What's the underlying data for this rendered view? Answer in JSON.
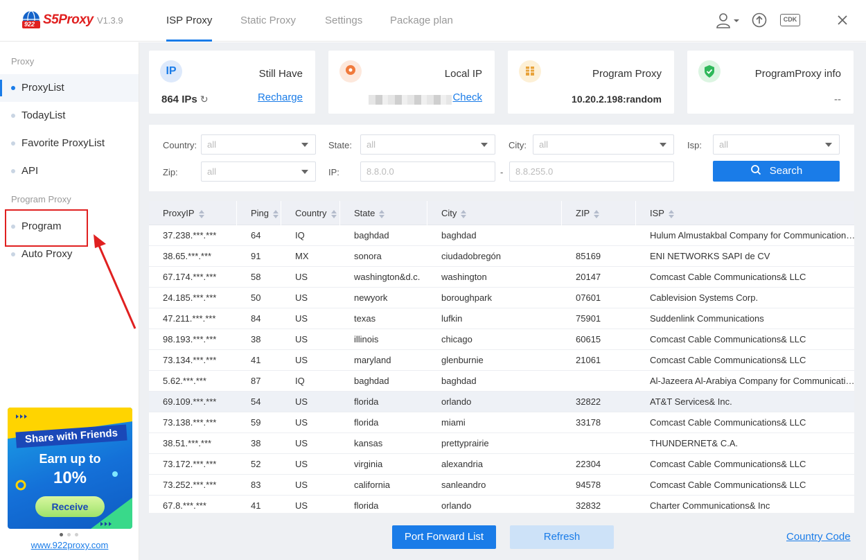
{
  "app": {
    "name": "S5Proxy",
    "logo_badge": "922",
    "version": "V1.3.9"
  },
  "nav_tabs": [
    "ISP Proxy",
    "Static Proxy",
    "Settings",
    "Package plan"
  ],
  "header_icons": [
    "user-icon",
    "upload-icon",
    "cdk-icon",
    "close-icon"
  ],
  "header": {
    "cdk_label": "CDK"
  },
  "sidebar": {
    "group1": "Proxy",
    "items1": [
      "ProxyList",
      "TodayList",
      "Favorite ProxyList",
      "API"
    ],
    "group2": "Program Proxy",
    "items2": [
      "Program",
      "Auto Proxy"
    ],
    "promo": {
      "line1": "Share with Friends",
      "line2": "Earn up to",
      "line3": "10%",
      "button": "Receive"
    },
    "site_link": "www.922proxy.com"
  },
  "cards": {
    "still_have": {
      "icon_label": "IP",
      "title": "Still Have",
      "count": "864 IPs",
      "link": "Recharge"
    },
    "local_ip": {
      "title": "Local IP",
      "link": "Check"
    },
    "program_proxy": {
      "title": "Program Proxy",
      "value": "10.20.2.198:random"
    },
    "program_proxy_info": {
      "title": "ProgramProxy info",
      "value": "--"
    }
  },
  "filter": {
    "country_label": "Country:",
    "country_value": "all",
    "state_label": "State:",
    "state_value": "all",
    "city_label": "City:",
    "city_value": "all",
    "isp_label": "Isp:",
    "isp_value": "all",
    "zip_label": "Zip:",
    "zip_value": "all",
    "ip_label": "IP:",
    "ip_from": "8.8.0.0",
    "ip_sep": "-",
    "ip_to": "8.8.255.0",
    "search_label": "Search"
  },
  "table": {
    "columns": [
      "ProxyIP",
      "Ping",
      "Country",
      "State",
      "City",
      "ZIP",
      "ISP"
    ],
    "rows": [
      [
        "37.238.***.***",
        "64",
        "IQ",
        "baghdad",
        "baghdad",
        "",
        "Hulum Almustakbal Company for Communication Engineering and Services Ltd"
      ],
      [
        "38.65.***.***",
        "91",
        "MX",
        "sonora",
        "ciudadobregón",
        "85169",
        "ENI NETWORKS SAPI de CV"
      ],
      [
        "67.174.***.***",
        "58",
        "US",
        "washington&d.c.",
        "washington",
        "20147",
        "Comcast Cable Communications& LLC"
      ],
      [
        "24.185.***.***",
        "50",
        "US",
        "newyork",
        "boroughpark",
        "07601",
        "Cablevision Systems Corp."
      ],
      [
        "47.211.***.***",
        "84",
        "US",
        "texas",
        "lufkin",
        "75901",
        "Suddenlink Communications"
      ],
      [
        "98.193.***.***",
        "38",
        "US",
        "illinois",
        "chicago",
        "60615",
        "Comcast Cable Communications& LLC"
      ],
      [
        "73.134.***.***",
        "41",
        "US",
        "maryland",
        "glenburnie",
        "21061",
        "Comcast Cable Communications& LLC"
      ],
      [
        "5.62.***.***",
        "87",
        "IQ",
        "baghdad",
        "baghdad",
        "",
        "Al-Jazeera Al-Arabiya Company for Communication and Internet LTD"
      ],
      [
        "69.109.***.***",
        "54",
        "US",
        "florida",
        "orlando",
        "32822",
        "AT&T Services& Inc."
      ],
      [
        "73.138.***.***",
        "59",
        "US",
        "florida",
        "miami",
        "33178",
        "Comcast Cable Communications& LLC"
      ],
      [
        "38.51.***.***",
        "38",
        "US",
        "kansas",
        "prettyprairie",
        "",
        "THUNDERNET& C.A."
      ],
      [
        "73.172.***.***",
        "52",
        "US",
        "virginia",
        "alexandria",
        "22304",
        "Comcast Cable Communications& LLC"
      ],
      [
        "73.252.***.***",
        "83",
        "US",
        "california",
        "sanleandro",
        "94578",
        "Comcast Cable Communications& LLC"
      ],
      [
        "67.8.***.***",
        "41",
        "US",
        "florida",
        "orlando",
        "32832",
        "Charter Communications& Inc"
      ]
    ]
  },
  "bottom": {
    "port_forward": "Port Forward List",
    "refresh": "Refresh",
    "country_code": "Country Code"
  },
  "colors": {
    "accent": "#1a7ce8",
    "annotation": "#e02020"
  }
}
